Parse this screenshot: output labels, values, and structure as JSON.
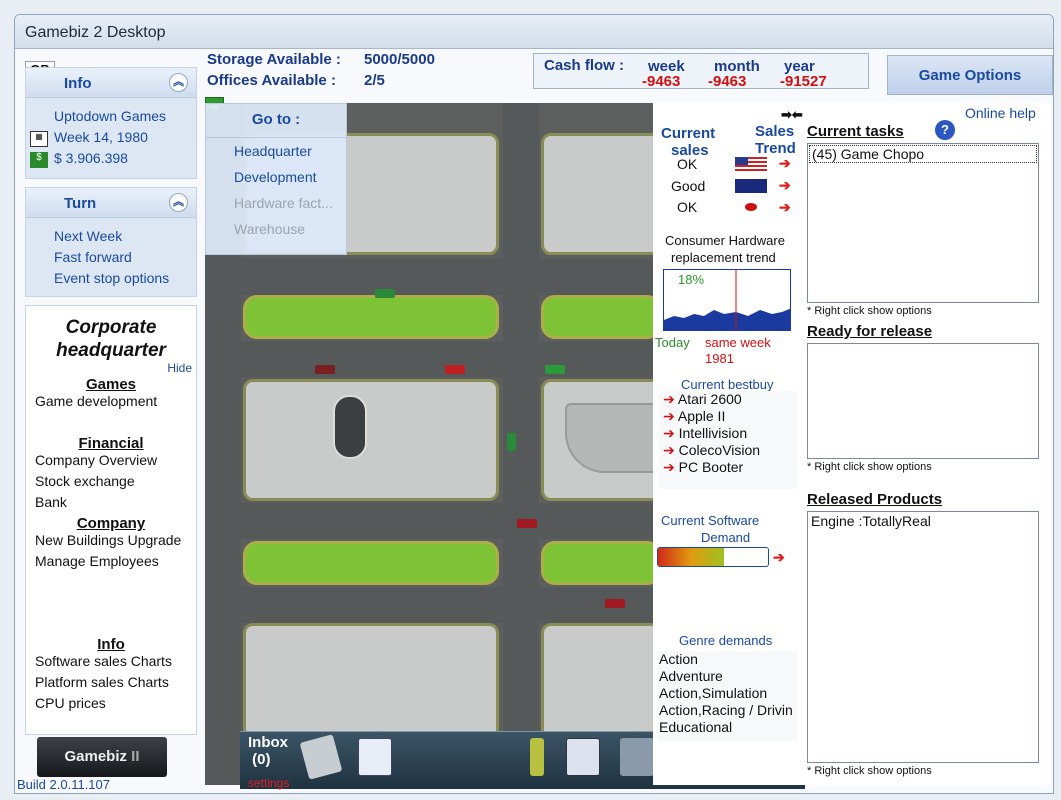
{
  "window": {
    "title": "Gamebiz 2 Desktop"
  },
  "top": {
    "storage_label": "Storage Available :",
    "storage_value": "5000/5000",
    "offices_label": "Offices Available :",
    "offices_value": "2/5",
    "cashflow_label": "Cash flow :",
    "week_label": "week",
    "week_value": "-9463",
    "month_label": "month",
    "month_value": "-9463",
    "year_label": "year",
    "year_value": "-91527",
    "game_options": "Game Options"
  },
  "info_panel": {
    "title": "Info",
    "company": "Uptodown Games",
    "date": "Week 14, 1980",
    "money": "$ 3.906.398"
  },
  "turn_panel": {
    "title": "Turn",
    "items": [
      "Next Week",
      "Fast forward",
      "Event stop options"
    ]
  },
  "goto": {
    "title": "Go to :",
    "items": [
      {
        "label": "Headquarter",
        "enabled": true
      },
      {
        "label": "Development",
        "enabled": true
      },
      {
        "label": "Hardware fact...",
        "enabled": false
      },
      {
        "label": "Warehouse",
        "enabled": false
      }
    ]
  },
  "corp": {
    "title_line1": "Corporate",
    "title_line2": "headquarter",
    "hide": "Hide",
    "sections": {
      "games": "Games",
      "games_items": [
        "Game development"
      ],
      "financial": "Financial",
      "financial_items": [
        "Company Overview",
        "Stock exchange",
        "Bank"
      ],
      "company": "Company",
      "company_items": [
        "New Buildings  Upgrade",
        "Manage Employees"
      ],
      "info": "Info",
      "info_items": [
        "Software sales Charts",
        "Platform sales Charts",
        "CPU prices"
      ]
    }
  },
  "logo": "Gamebiz",
  "build": "Build 2.0.11.107",
  "toolbar": {
    "inbox": "Inbox",
    "inbox_count": "(0)",
    "settings": "settings"
  },
  "sales": {
    "current_label1": "Current",
    "current_label2": "sales",
    "trend_label1": "Sales",
    "trend_label2": "Trend",
    "rows": [
      {
        "status": "OK",
        "region": "usa-flag-icon"
      },
      {
        "status": "Good",
        "region": "eu-flag-icon"
      },
      {
        "status": "OK",
        "region": "japan-flag-icon"
      }
    ]
  },
  "hardware": {
    "title1": "Consumer Hardware",
    "title2": "replacement trend",
    "percent": "18%",
    "today": "Today",
    "same_week": "same week",
    "year": "1981"
  },
  "bestbuy": {
    "title": "Current bestbuy",
    "items": [
      "Atari 2600",
      "Apple II",
      "Intellivision",
      "ColecoVision",
      "PC Booter"
    ]
  },
  "software_demand": {
    "title1": "Current Software",
    "title2": "Demand",
    "level": 0.6
  },
  "genre": {
    "title": "Genre demands",
    "items": [
      "Action",
      "Adventure",
      "Action,Simulation",
      "Action,Racing / Drivin",
      "Educational"
    ]
  },
  "right": {
    "online_help": "Online help",
    "current_tasks": "Current tasks",
    "tasks": [
      "(45) Game Chopo"
    ],
    "right_click": "* Right click show options",
    "ready": "Ready for release",
    "released": "Released Products",
    "released_items": [
      "Engine :TotallyReal"
    ]
  },
  "colors": {
    "accent": "#1a4aa0",
    "negative": "#d01010",
    "panel": "#dde7f4"
  }
}
